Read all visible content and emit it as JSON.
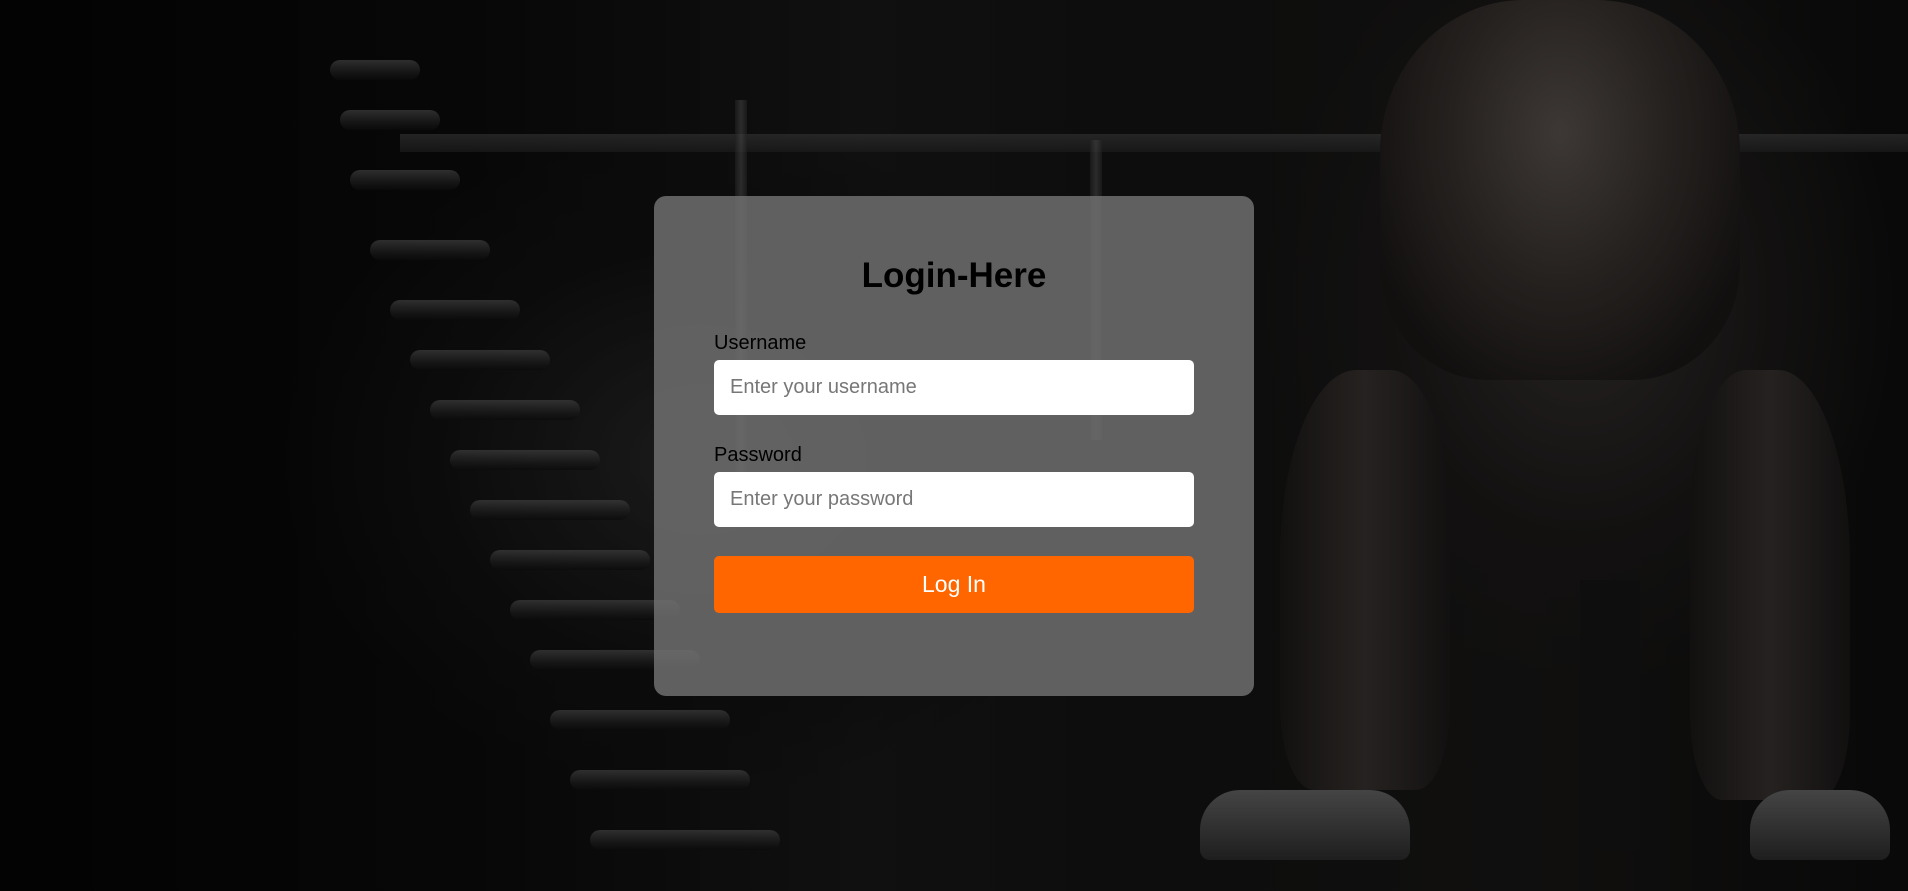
{
  "login": {
    "title": "Login-Here",
    "username_label": "Username",
    "username_placeholder": "Enter your username",
    "password_label": "Password",
    "password_placeholder": "Enter your password",
    "submit_label": "Log In"
  },
  "colors": {
    "accent": "#ff6600",
    "card_background": "#737373",
    "input_background": "#ffffff"
  }
}
